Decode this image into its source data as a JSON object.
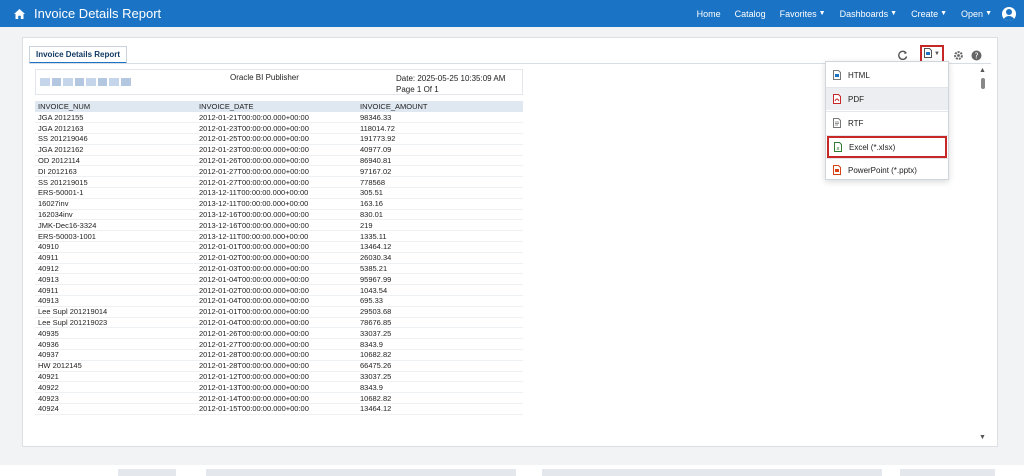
{
  "app": {
    "title": "Invoice Details Report"
  },
  "nav": {
    "items": [
      {
        "label": "Home",
        "dropdown": false
      },
      {
        "label": "Catalog",
        "dropdown": false
      },
      {
        "label": "Favorites",
        "dropdown": true
      },
      {
        "label": "Dashboards",
        "dropdown": true
      },
      {
        "label": "Create",
        "dropdown": true
      },
      {
        "label": "Open",
        "dropdown": true
      }
    ]
  },
  "tab": {
    "label": "Invoice Details Report"
  },
  "report": {
    "publisher": "Oracle BI Publisher",
    "date": "Date: 2025-05-25 10:35:09 AM",
    "page": "Page 1 Of 1"
  },
  "table": {
    "headers": [
      "INVOICE_NUM",
      "INVOICE_DATE",
      "INVOICE_AMOUNT"
    ],
    "rows": [
      [
        "JGA 2012155",
        "2012-01-21T00:00:00.000+00:00",
        "98346.33"
      ],
      [
        "JGA 2012163",
        "2012-01-23T00:00:00.000+00:00",
        "118014.72"
      ],
      [
        "SS 201219046",
        "2012-01-25T00:00:00.000+00:00",
        "191773.92"
      ],
      [
        "JGA 2012162",
        "2012-01-23T00:00:00.000+00:00",
        "40977.09"
      ],
      [
        "OD 2012114",
        "2012-01-26T00:00:00.000+00:00",
        "86940.81"
      ],
      [
        "DI 2012163",
        "2012-01-27T00:00:00.000+00:00",
        "97167.02"
      ],
      [
        "SS 201219015",
        "2012-01-27T00:00:00.000+00:00",
        "778568"
      ],
      [
        "ERS-50001-1",
        "2013-12-11T00:00:00.000+00:00",
        "305.51"
      ],
      [
        "16027inv",
        "2013-12-11T00:00:00.000+00:00",
        "163.16"
      ],
      [
        "162034inv",
        "2013-12-16T00:00:00.000+00:00",
        "830.01"
      ],
      [
        "JMK-Dec16-3324",
        "2013-12-16T00:00:00.000+00:00",
        "219"
      ],
      [
        "ERS-50003-1001",
        "2013-12-11T00:00:00.000+00:00",
        "1335.11"
      ],
      [
        "40910",
        "2012-01-01T00:00:00.000+00:00",
        "13464.12"
      ],
      [
        "40911",
        "2012-01-02T00:00:00.000+00:00",
        "26030.34"
      ],
      [
        "40912",
        "2012-01-03T00:00:00.000+00:00",
        "5385.21"
      ],
      [
        "40913",
        "2012-01-04T00:00:00.000+00:00",
        "95967.99"
      ],
      [
        "40911",
        "2012-01-02T00:00:00.000+00:00",
        "1043.54"
      ],
      [
        "40913",
        "2012-01-04T00:00:00.000+00:00",
        "695.33"
      ],
      [
        "Lee Supl 201219014",
        "2012-01-01T00:00:00.000+00:00",
        "29503.68"
      ],
      [
        "Lee Supl 201219023",
        "2012-01-04T00:00:00.000+00:00",
        "78676.85"
      ],
      [
        "40935",
        "2012-01-26T00:00:00.000+00:00",
        "33037.25"
      ],
      [
        "40936",
        "2012-01-27T00:00:00.000+00:00",
        "8343.9"
      ],
      [
        "40937",
        "2012-01-28T00:00:00.000+00:00",
        "10682.82"
      ],
      [
        "HW 2012145",
        "2012-01-28T00:00:00.000+00:00",
        "66475.26"
      ],
      [
        "40921",
        "2012-01-12T00:00:00.000+00:00",
        "33037.25"
      ],
      [
        "40922",
        "2012-01-13T00:00:00.000+00:00",
        "8343.9"
      ],
      [
        "40923",
        "2012-01-14T00:00:00.000+00:00",
        "10682.82"
      ],
      [
        "40924",
        "2012-01-15T00:00:00.000+00:00",
        "13464.12"
      ]
    ]
  },
  "export_menu": {
    "items": [
      {
        "label": "HTML",
        "icon": "html-file-icon"
      },
      {
        "label": "PDF",
        "icon": "pdf-file-icon"
      },
      {
        "label": "RTF",
        "icon": "rtf-file-icon"
      },
      {
        "label": "Excel (*.xlsx)",
        "icon": "excel-file-icon"
      },
      {
        "label": "PowerPoint (*.pptx)",
        "icon": "powerpoint-file-icon"
      }
    ]
  },
  "colors": {
    "topbar": "#1a73c4",
    "highlight_border": "#c62828",
    "table_header": "#dfe8f1"
  }
}
